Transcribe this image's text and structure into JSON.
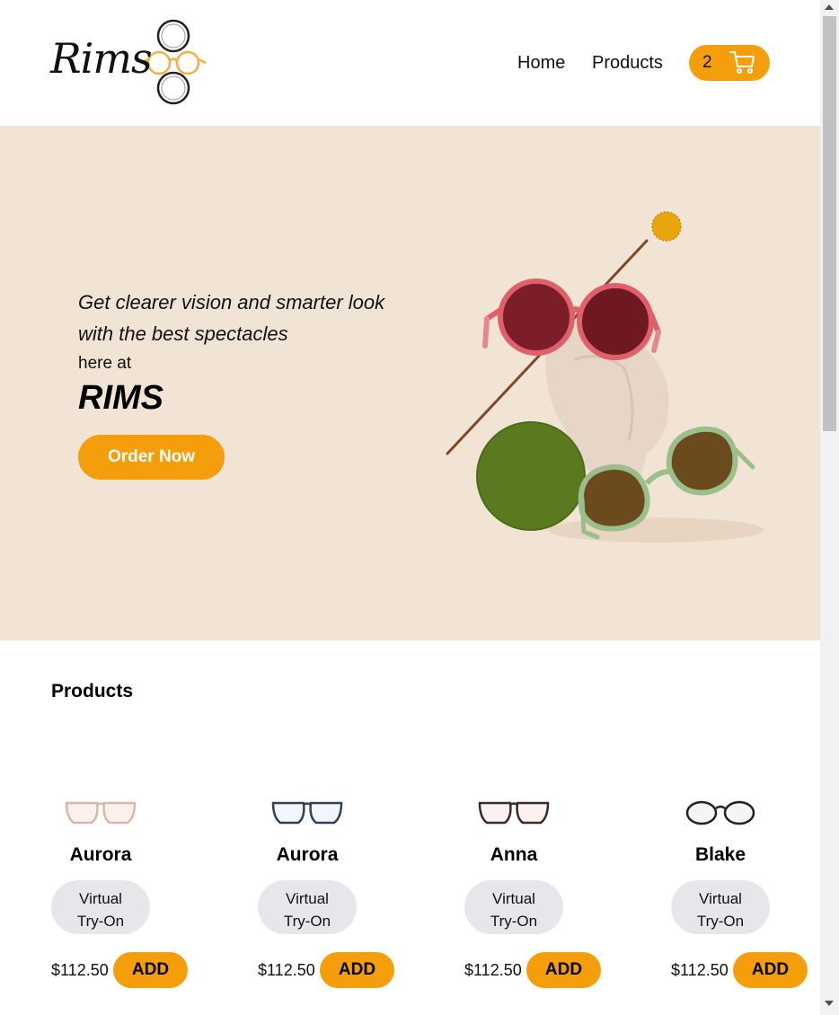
{
  "header": {
    "logo_text": "Rims",
    "nav": {
      "home": "Home",
      "products": "Products"
    },
    "cart": {
      "count": "2",
      "icon": "shopping-cart-icon"
    }
  },
  "hero": {
    "line1": "Get clearer vision and smarter look",
    "line2": "with the best spectacles",
    "here_at": "here at",
    "brand": "RIMS",
    "order_button": "Order Now",
    "background": "#f1e4d5",
    "accent": "#f59e0b"
  },
  "products": {
    "title": "Products",
    "items": [
      {
        "name": "Aurora",
        "try_on": [
          "Virtual",
          "Try-On"
        ],
        "price": "$112.50",
        "add": "ADD",
        "frame_color": "#d9b8a8"
      },
      {
        "name": "Aurora",
        "try_on": [
          "Virtual",
          "Try-On"
        ],
        "price": "$112.50",
        "add": "ADD",
        "frame_color": "#334155"
      },
      {
        "name": "Anna",
        "try_on": [
          "Virtual",
          "Try-On"
        ],
        "price": "$112.50",
        "add": "ADD",
        "frame_color": "#3a2a2a"
      },
      {
        "name": "Blake",
        "try_on": [
          "Virtual",
          "Try-On"
        ],
        "price": "$112.50",
        "add": "ADD",
        "frame_color": "#222222"
      }
    ]
  }
}
